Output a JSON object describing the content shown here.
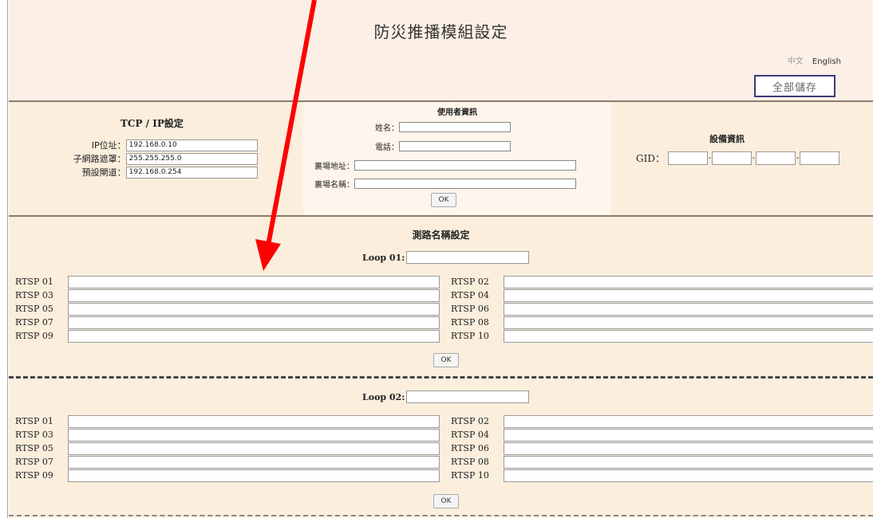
{
  "header": {
    "title": "防災推播模組設定",
    "lang_zh": "中文",
    "lang_en": "English",
    "save_all": "全部儲存"
  },
  "tcp": {
    "title": "TCP / IP設定",
    "ip_label": "IP位址：",
    "ip_value": "192.168.0.10",
    "mask_label": "子網路遮罩：",
    "mask_value": "255.255.255.0",
    "gateway_label": "預設閘道：",
    "gateway_value": "192.168.0.254"
  },
  "user": {
    "title": "使用者資訊",
    "name_label": "姓名：",
    "phone_label": "電話：",
    "address_label": "裏場地址：",
    "site_label": "裏場名稱：",
    "ok": "OK"
  },
  "device": {
    "title": "設備資訊",
    "gid_label": "GID："
  },
  "loops_title": "測路名稱設定",
  "loops": [
    {
      "label": "Loop 01",
      "rtsp": [
        "RTSP 01",
        "RTSP 02",
        "RTSP 03",
        "RTSP 04",
        "RTSP 05",
        "RTSP 06",
        "RTSP 07",
        "RTSP 08",
        "RTSP 09",
        "RTSP 10"
      ],
      "ok": "OK"
    },
    {
      "label": "Loop 02",
      "rtsp": [
        "RTSP 01",
        "RTSP 02",
        "RTSP 03",
        "RTSP 04",
        "RTSP 05",
        "RTSP 06",
        "RTSP 07",
        "RTSP 08",
        "RTSP 09",
        "RTSP 10"
      ],
      "ok": "OK"
    }
  ],
  "colors": {
    "arrow": "#ff0000",
    "save_border": "#3b3b7a"
  }
}
